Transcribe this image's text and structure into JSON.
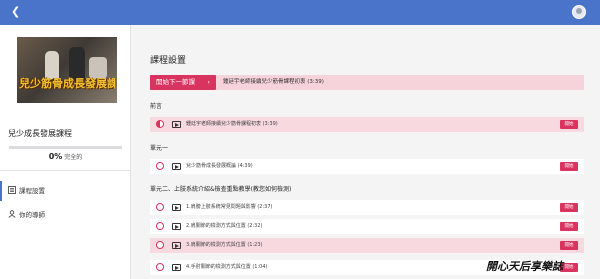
{
  "header": {
    "bg_color": "#4a74c9"
  },
  "sidebar": {
    "cover_title": "兒少筋骨成長發展課程",
    "course_name": "兒少成長發展課程",
    "progress_percent": "0%",
    "progress_value": 0,
    "progress_suffix": "完全的",
    "nav": [
      {
        "label": "課程設置",
        "icon": "list-icon"
      },
      {
        "label": "你的導師",
        "icon": "person-icon"
      }
    ]
  },
  "main": {
    "title": "課程設置",
    "next_button": "開始下一節課",
    "next_lesson_text": "鍾廷宇老師接續兒少筋骨課程初衷 (3:39)",
    "sections": [
      {
        "title": "前言",
        "lessons": [
          {
            "text": "鍾廷宇老師接續兒少筋骨課程初衷 (3:39)",
            "button": "開始",
            "highlight": true,
            "state": "half"
          }
        ]
      },
      {
        "title": "單元一",
        "lessons": [
          {
            "text": "兒少筋骨成長發展概論 (4:39)",
            "button": "開始",
            "highlight": false,
            "state": "empty"
          }
        ]
      },
      {
        "title": "單元二、上肢系統介紹&檢查重點教學(教您如何檢測)",
        "lessons": [
          {
            "text": "1.肩膀上肢系統常見問題與影響 (2:37)",
            "button": "開始",
            "highlight": false,
            "state": "empty"
          },
          {
            "text": "2.肩關節的檢測方式與位置 (2:32)",
            "button": "開始",
            "highlight": false,
            "state": "empty"
          },
          {
            "text": "3.肩關節的檢測方式與位置 (1:23)",
            "button": "開始",
            "highlight": true,
            "state": "empty"
          },
          {
            "text": "4.手肘關節的檢測方式與位置 (1:04)",
            "button": "開始",
            "highlight": false,
            "state": "empty"
          }
        ]
      }
    ]
  },
  "watermark": "開心天后享樂誌",
  "colors": {
    "accent": "#d9345f",
    "highlight": "#f8d9e0"
  }
}
